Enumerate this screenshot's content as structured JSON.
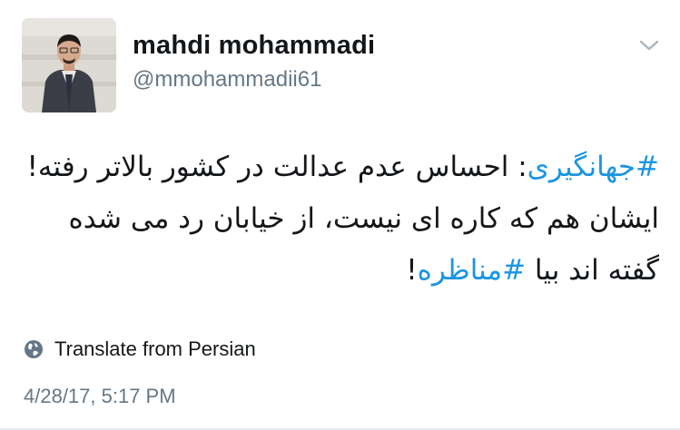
{
  "tweet": {
    "author": {
      "display_name": "mahdi mohammadi",
      "handle": "@mmohammadii61"
    },
    "body_segments": [
      {
        "text": "#جهانگیری",
        "kind": "hashtag"
      },
      {
        "text": ": احساس عدم عدالت در کشور بالاتر رفته! ایشان هم که کاره ای نیست، از خیابان رد می شده گفته اند بیا ",
        "kind": "text"
      },
      {
        "text": "#مناظره",
        "kind": "hashtag"
      },
      {
        "text": "!",
        "kind": "text"
      }
    ],
    "translate_label": "Translate from Persian",
    "timestamp": "4/28/17, 5:17 PM"
  },
  "icons": {
    "menu": "chevron-down-icon",
    "translate": "globe-icon"
  },
  "colors": {
    "hashtag": "#1b95e0",
    "name": "#14171a",
    "secondary": "#657786"
  }
}
